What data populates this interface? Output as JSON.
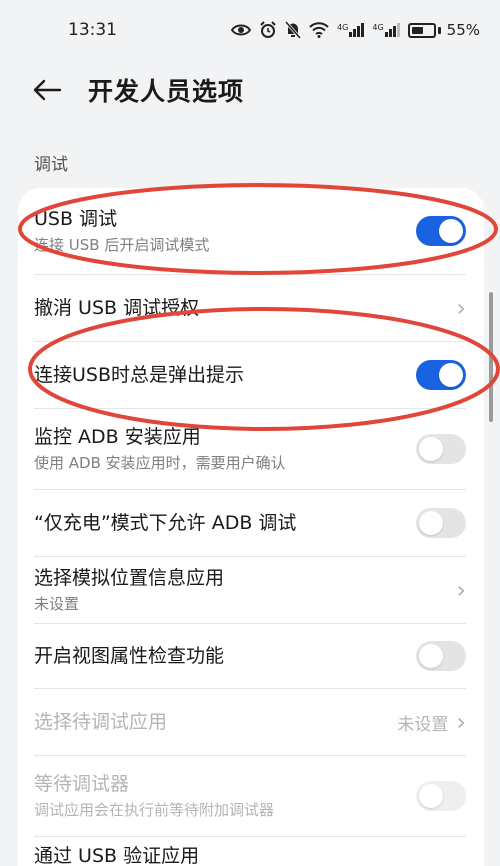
{
  "status_bar": {
    "time": "13:31",
    "network_4g_a": "4G",
    "network_4g_b": "4G",
    "battery_percent": "55%",
    "battery_level": 0.55
  },
  "header": {
    "title": "开发人员选项"
  },
  "section": {
    "label": "调试"
  },
  "settings": [
    {
      "title": "USB 调试",
      "subtitle": "连接 USB 后开启调试模式",
      "control": "toggle",
      "on": true
    },
    {
      "title": "撤消 USB 调试授权",
      "control": "chevron"
    },
    {
      "title": "连接USB时总是弹出提示",
      "control": "toggle",
      "on": true
    },
    {
      "title": "监控 ADB 安装应用",
      "subtitle": "使用 ADB 安装应用时，需要用户确认",
      "control": "toggle",
      "on": false
    },
    {
      "title": "“仅充电”模式下允许 ADB 调试",
      "control": "toggle",
      "on": false
    },
    {
      "title": "选择模拟位置信息应用",
      "subtitle": "未设置",
      "control": "chevron"
    },
    {
      "title": "开启视图属性检查功能",
      "control": "toggle",
      "on": false
    },
    {
      "title": "选择待调试应用",
      "value": "未设置",
      "control": "value-chevron",
      "disabled": true
    },
    {
      "title": "等待调试器",
      "subtitle": "调试应用会在执行前等待附加调试器",
      "control": "toggle",
      "on": false,
      "disabled": true
    },
    {
      "title": "通过 USB 验证应用"
    }
  ],
  "colors": {
    "accent": "#1a63e0",
    "annotation": "#e0473a"
  }
}
